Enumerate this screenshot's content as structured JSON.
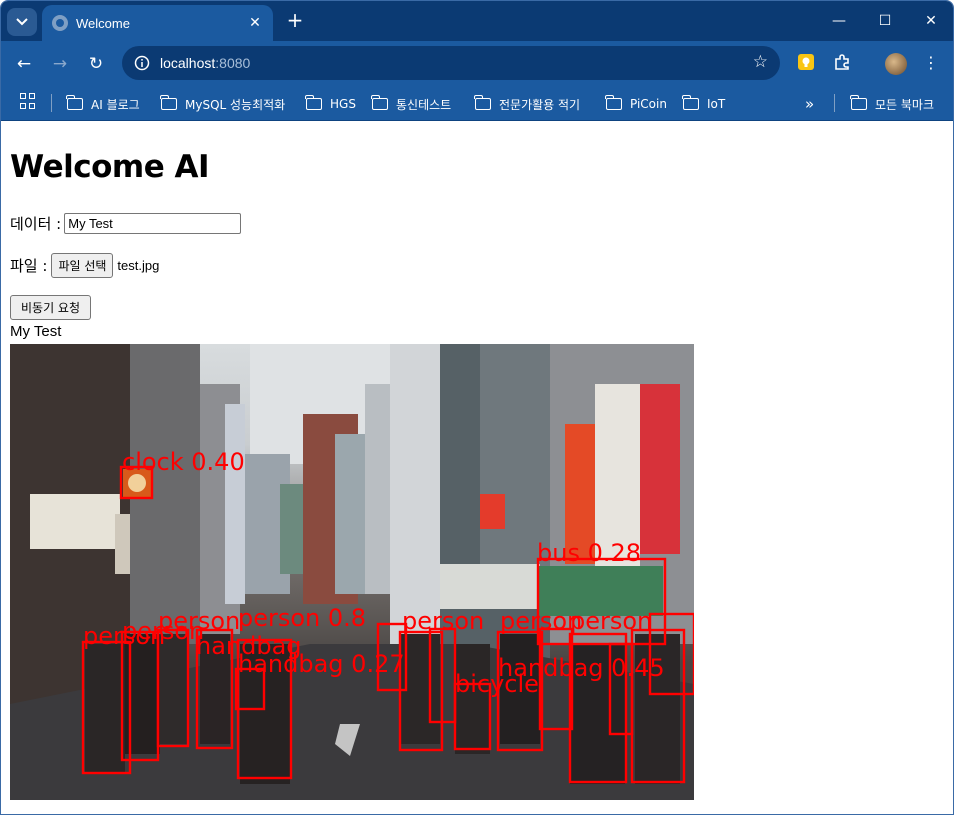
{
  "browser": {
    "tab": {
      "title": "Welcome"
    },
    "address": {
      "host": "localhost",
      "port": ":8080"
    },
    "bookmarks": [
      {
        "label": "AI 블로그"
      },
      {
        "label": "MySQL 성능최적화"
      },
      {
        "label": "HGS"
      },
      {
        "label": "통신테스트"
      },
      {
        "label": "전문가활용 적기"
      },
      {
        "label": "PiCoin"
      },
      {
        "label": "IoT"
      }
    ],
    "all_bookmarks": "모든 북마크",
    "more_bookmarks": "»"
  },
  "page": {
    "heading": "Welcome AI",
    "data_label": "데이터 :",
    "data_value": "My Test",
    "file_label": "파일 :",
    "file_button": "파일 선택",
    "file_name": "test.jpg",
    "submit_button": "비동기 요청",
    "result_text": "My Test"
  },
  "detection_labels": [
    "clock 0.40",
    "bus 0.28",
    "person",
    "person",
    "person",
    "person 0.8",
    "handbag 0.27",
    "handbag",
    "handbag 0.45",
    "bicycle",
    "person",
    "person",
    "person"
  ],
  "colors": {
    "tabstrip": "#0b3a73",
    "toolbar": "#1b5aa0",
    "detection_box": "#ff0000"
  }
}
